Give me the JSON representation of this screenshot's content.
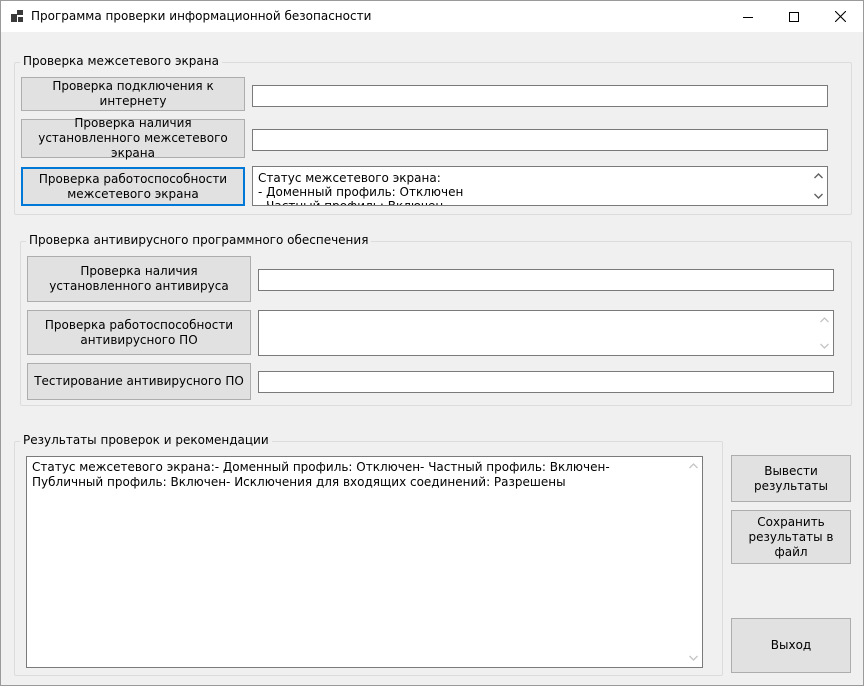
{
  "window": {
    "title": "Программа проверки информационной безопасности"
  },
  "firewall_group": {
    "label": "Проверка межсетевого экрана",
    "btn_internet": "Проверка подключения к интернету",
    "btn_installed": "Проверка наличия установленного межсетевого экрана",
    "btn_working": "Проверка работоспособности межсетевого экрана",
    "internet_value": "",
    "installed_value": "",
    "status_text": "Статус межсетевого экрана:\n- Доменный профиль: Отключен\n- Частный профиль: Включен"
  },
  "antivirus_group": {
    "label": "Проверка антивирусного программного обеспечения",
    "btn_installed": "Проверка наличия установленного антивируса",
    "btn_working": "Проверка работоспособности антивирусного ПО",
    "btn_test": "Тестирование антивирусного ПО",
    "installed_value": "",
    "working_value": "",
    "test_value": ""
  },
  "results_group": {
    "label": "Результаты проверок и рекомендации",
    "text": "Статус межсетевого экрана:- Доменный профиль: Отключен- Частный профиль: Включен- Публичный профиль: Включен- Исключения для входящих соединений: Разрешены"
  },
  "actions": {
    "show_results": "Вывести результаты",
    "save_results": "Сохранить результаты в файл",
    "exit": "Выход"
  },
  "colors": {
    "focus_border": "#0078d7",
    "button_face": "#e1e1e1",
    "window_background": "#f0f0f0"
  },
  "icons": [
    "app-icon",
    "minimize-icon",
    "maximize-icon",
    "close-icon",
    "scroll-up-icon",
    "scroll-down-icon"
  ]
}
